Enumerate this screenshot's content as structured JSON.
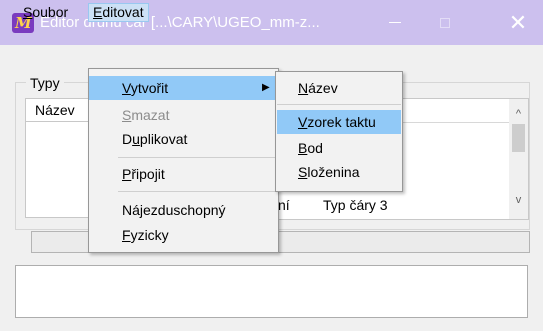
{
  "window": {
    "title": "Editor druhů čar [...\\CARY\\UGEO_mm-z...",
    "icon": "app-logo-icon",
    "icon_letter": "M",
    "accent_color": "#ccc0ee",
    "controls": {
      "minimize_icon": "minimize-icon",
      "maximize_icon": "maximize-icon",
      "close_glyph": "✕"
    }
  },
  "menubar": {
    "items": [
      {
        "pre": "",
        "accel": "S",
        "post": "oubor"
      },
      {
        "pre": "",
        "accel": "E",
        "post": "ditovat"
      }
    ]
  },
  "main": {
    "group_label": "Typy",
    "left_list": {
      "header": "Název"
    },
    "right_list": {
      "visible_row": [
        "ní",
        "Typ čáry 3"
      ],
      "scroll_up": "^",
      "scroll_down": "v"
    }
  },
  "menu_editovat": {
    "items": [
      {
        "pre": "",
        "accel": "V",
        "post": "ytvořit",
        "submenu_arrow": "▶",
        "highlighted": true
      },
      {
        "pre": "",
        "accel": "S",
        "post": "mazat",
        "disabled": true
      },
      {
        "pre": "D",
        "accel": "u",
        "post": "plikovat"
      },
      {
        "pre": "",
        "accel": "P",
        "post": "řipojit"
      },
      {
        "pre": "Nájezduschopný",
        "accel": "",
        "post": ""
      },
      {
        "pre": "",
        "accel": "F",
        "post": "yzicky"
      }
    ]
  },
  "menu_vytvorit": {
    "items": [
      {
        "pre": "",
        "accel": "N",
        "post": "ázev"
      },
      {
        "pre": "",
        "accel": "V",
        "post": "zorek taktu",
        "highlighted": true
      },
      {
        "pre": "",
        "accel": "B",
        "post": "od"
      },
      {
        "pre": "",
        "accel": "S",
        "post": "loženina"
      }
    ]
  },
  "colors": {
    "highlight": "#91c9f7",
    "menubar_active": "#cce0f5",
    "disabled_text": "#8c8c8c"
  }
}
